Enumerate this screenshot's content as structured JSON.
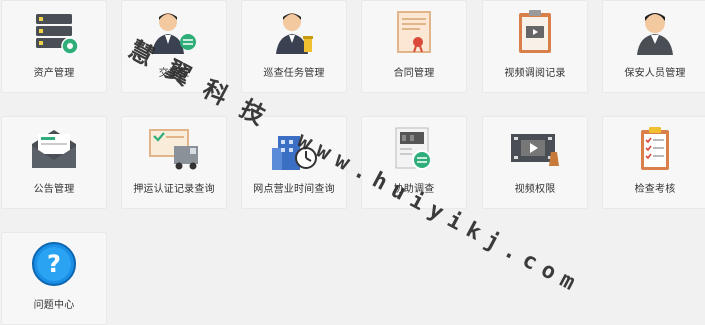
{
  "tiles": [
    {
      "label": "资产管理",
      "icon": "server-gear-icon",
      "interactable": true
    },
    {
      "label": "交接班",
      "icon": "officers-handover-icon",
      "interactable": true
    },
    {
      "label": "巡查任务管理",
      "icon": "officer-task-icon",
      "interactable": true
    },
    {
      "label": "合同管理",
      "icon": "contract-certificate-icon",
      "interactable": true
    },
    {
      "label": "视频调阅记录",
      "icon": "video-clipboard-icon",
      "interactable": true
    },
    {
      "label": "保安人员管理",
      "icon": "security-guard-icon",
      "interactable": true
    },
    {
      "label": "公告管理",
      "icon": "envelope-notice-icon",
      "interactable": true
    },
    {
      "label": "押运认证记录查询",
      "icon": "armored-truck-icon",
      "interactable": true
    },
    {
      "label": "网点营业时间查询",
      "icon": "building-clock-icon",
      "interactable": true
    },
    {
      "label": "协助调查",
      "icon": "film-search-icon",
      "interactable": true
    },
    {
      "label": "视频权限",
      "icon": "film-strip-icon",
      "interactable": true
    },
    {
      "label": "检查考核",
      "icon": "checklist-icon",
      "interactable": true
    },
    {
      "label": "问题中心",
      "icon": "question-circle-icon",
      "interactable": true
    }
  ],
  "watermark": {
    "cn": "慧翼科技",
    "url": "www.huiyikj.com"
  }
}
